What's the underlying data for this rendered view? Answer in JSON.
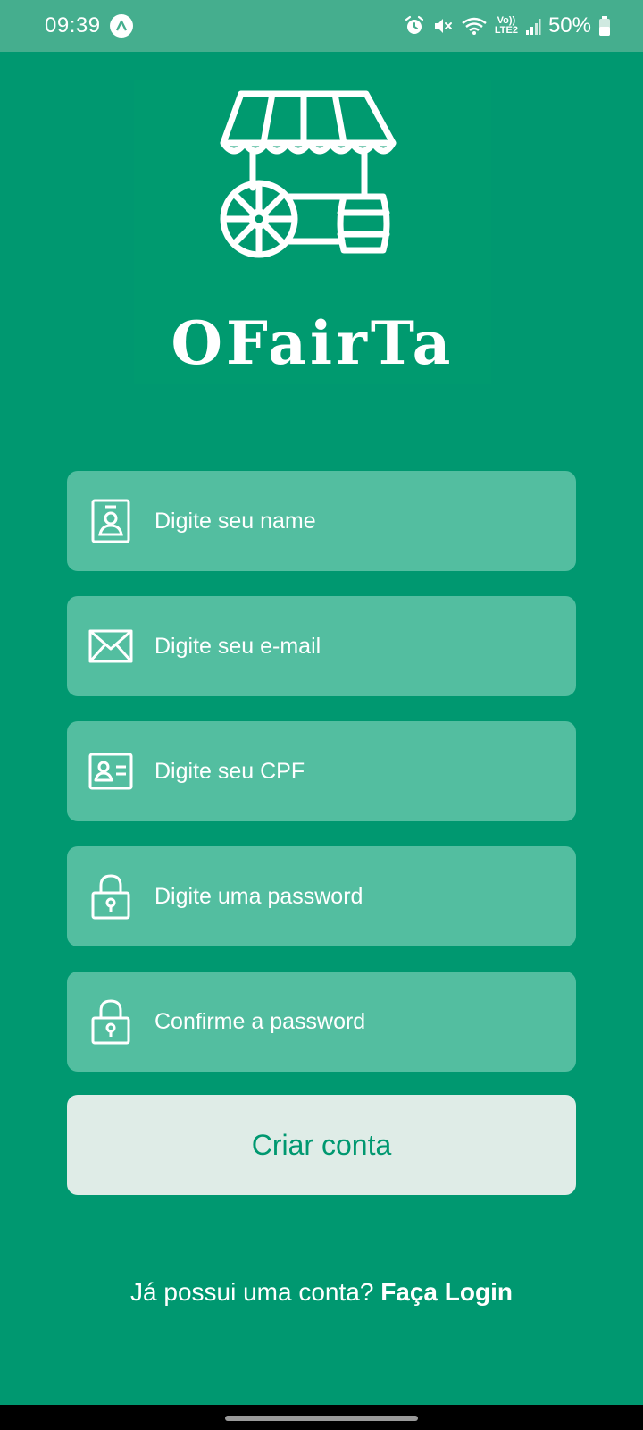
{
  "status_bar": {
    "time": "09:39",
    "battery": "50%",
    "icons": [
      "app-notification-icon",
      "alarm-icon",
      "mute-icon",
      "wifi-icon",
      "volte-lte2-icon",
      "signal-icon",
      "battery-icon"
    ],
    "network_label_top": "Vo))",
    "network_label_bottom": "LTE2"
  },
  "logo": {
    "text": "OFairTa",
    "icon": "market-cart-icon"
  },
  "form": {
    "fields": [
      {
        "placeholder": "Digite seu name",
        "value": "",
        "icon": "user-badge-icon"
      },
      {
        "placeholder": "Digite seu e-mail",
        "value": "",
        "icon": "envelope-icon"
      },
      {
        "placeholder": "Digite seu CPF",
        "value": "",
        "icon": "id-card-icon"
      },
      {
        "placeholder": "Digite uma password",
        "value": "",
        "icon": "lock-icon"
      },
      {
        "placeholder": "Confirme a password",
        "value": "",
        "icon": "lock-icon"
      }
    ],
    "submit_label": "Criar conta"
  },
  "footer": {
    "prompt": "Já possui uma conta?",
    "link_label": "Faça Login"
  },
  "colors": {
    "background": "#009870",
    "status_bar": "#45ae8e",
    "field": "#53bea0",
    "button": "#dfece7",
    "button_text": "#009870"
  }
}
